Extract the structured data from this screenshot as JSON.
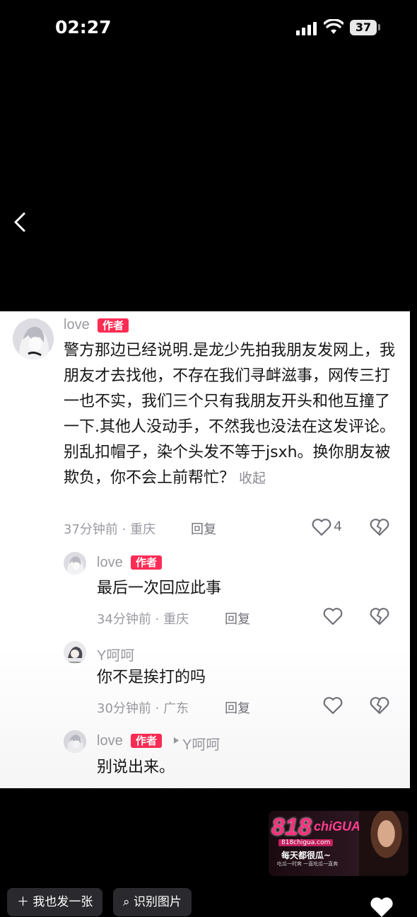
{
  "status_bar": {
    "time": "02:27",
    "battery": "37"
  },
  "comments": [
    {
      "username": "love",
      "badge": "作者",
      "text": "警方那边已经说明.是龙少先拍我朋友发网上，我朋友才去找他，不存在我们寻衅滋事，网传三打一也不实，我们三个只有我朋友开头和他互撞了一下.其他人没动手，不然我也没法在这发评论。别乱扣帽子，染个头发不等于jsxh。换你朋友被欺负，你不会上前帮忙？",
      "collapse_label": "收起",
      "time": "37分钟前",
      "location": "重庆",
      "reply_label": "回复",
      "likes": "4"
    },
    {
      "username": "love",
      "badge": "作者",
      "text": "最后一次回应此事",
      "time": "34分钟前",
      "location": "重庆",
      "reply_label": "回复"
    },
    {
      "username": "Y呵呵",
      "text": "你不是挨打的吗",
      "time": "30分钟前",
      "location": "广东",
      "reply_label": "回复"
    },
    {
      "username": "love",
      "badge": "作者",
      "reply_to": "Y呵呵",
      "text": "别说出来。"
    }
  ],
  "meta_separator": "·",
  "watermark": {
    "logo": "818",
    "logo_suffix": "chiGUA",
    "url": "818chigua.com",
    "slogan": "每天都很瓜~",
    "small": "吃瓜一时爽 一直吃瓜一直爽"
  },
  "bottom_bar": {
    "post_button": "我也发一张",
    "identify_button": "识别图片"
  }
}
